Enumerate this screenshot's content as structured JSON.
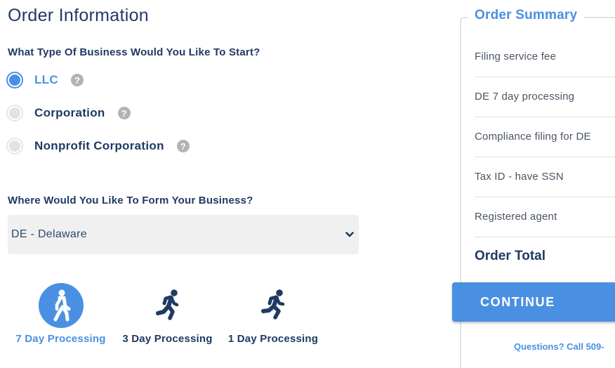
{
  "order_info": {
    "title": "Order Information",
    "business_type_question": "What Type Of Business Would You Like To Start?",
    "business_types": [
      {
        "label": "LLC",
        "selected": true,
        "help_icon": "question-circle-icon"
      },
      {
        "label": "Corporation",
        "selected": false,
        "help_icon": "question-circle-icon"
      },
      {
        "label": "Nonprofit Corporation",
        "selected": false,
        "help_icon": "question-circle-icon"
      }
    ],
    "help_glyph": "?",
    "state_question": "Where Would You Like To Form Your Business?",
    "state_select": {
      "value": "DE - Delaware",
      "icon": "chevron-down-icon"
    },
    "processing_options": [
      {
        "label": "7 Day Processing",
        "icon": "walking-person-icon",
        "selected": true
      },
      {
        "label": "3 Day Processing",
        "icon": "running-person-icon",
        "selected": false
      },
      {
        "label": "1 Day Processing",
        "icon": "running-person-icon",
        "selected": false
      }
    ]
  },
  "order_summary": {
    "title": "Order Summary",
    "items": [
      "Filing service fee",
      "DE 7 day processing",
      "Compliance filing for DE",
      "Tax ID - have SSN",
      "Registered agent"
    ],
    "total_label": "Order Total",
    "continue_label": "CONTINUE",
    "questions_text": "Questions? Call 509-"
  },
  "colors": {
    "accent": "#4a90e2",
    "navy": "#1f3a63",
    "select_bg": "#f0f0f0",
    "help_gray": "#b3b3b3"
  }
}
